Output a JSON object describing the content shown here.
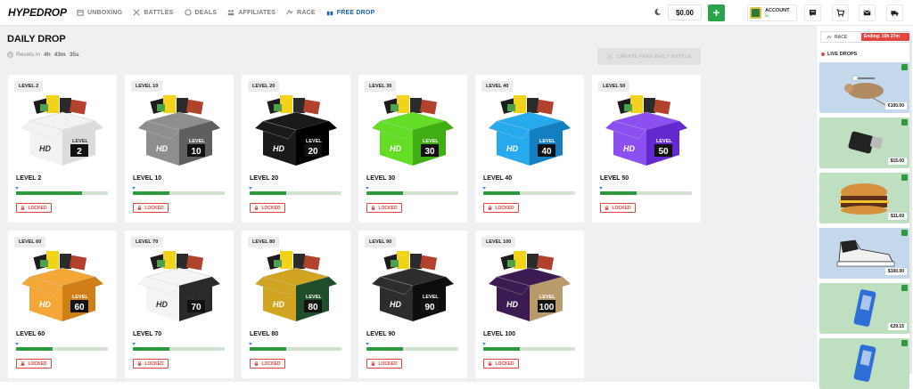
{
  "header": {
    "logo": "HYPEDROP",
    "nav": [
      {
        "label": "UNBOXING",
        "icon": "box-icon"
      },
      {
        "label": "BATTLES",
        "icon": "swords-icon"
      },
      {
        "label": "DEALS",
        "icon": "deals-icon"
      },
      {
        "label": "AFFILIATES",
        "icon": "affiliates-icon"
      },
      {
        "label": "RACE",
        "icon": "race-icon"
      },
      {
        "label": "FREE DROP",
        "icon": "gift-icon",
        "active": true
      }
    ],
    "balance": "$0.00",
    "account_label": "ACCOUNT",
    "account_sub": "$0"
  },
  "page": {
    "title": "DAILY DROP",
    "resets_label": "Resets in",
    "resets_h": "4h",
    "resets_m": "43m",
    "resets_s": "35s",
    "create_button": "CREATE FREE DAILY BATTLE"
  },
  "cards": [
    {
      "tag": "LEVEL 2",
      "name": "LEVEL 2",
      "box_label": "LEVEL",
      "box_num": "2",
      "color": "#f2f2f2",
      "dark": "#dcdcdc",
      "status": "LOCKED",
      "progress": 0.72
    },
    {
      "tag": "LEVEL 10",
      "name": "LEVEL 10",
      "box_label": "LEVEL",
      "box_num": "10",
      "color": "#8e8e8e",
      "dark": "#5f5f5f",
      "status": "LOCKED",
      "progress": 0.4
    },
    {
      "tag": "LEVEL 20",
      "name": "LEVEL 20",
      "box_label": "LEVEL",
      "box_num": "20",
      "color": "#1a1a1a",
      "dark": "#000000",
      "status": "LOCKED",
      "progress": 0.4
    },
    {
      "tag": "LEVEL 30",
      "name": "LEVEL 30",
      "box_label": "LEVEL",
      "box_num": "30",
      "color": "#63dd25",
      "dark": "#3fae12",
      "status": "LOCKED",
      "progress": 0.4
    },
    {
      "tag": "LEVEL 40",
      "name": "LEVEL 40",
      "box_label": "LEVEL",
      "box_num": "40",
      "color": "#27a9ee",
      "dark": "#137ec0",
      "status": "LOCKED",
      "progress": 0.4
    },
    {
      "tag": "LEVEL 50",
      "name": "LEVEL 50",
      "box_label": "LEVEL",
      "box_num": "50",
      "color": "#8c4ff0",
      "dark": "#6428cf",
      "status": "LOCKED",
      "progress": 0.4
    },
    {
      "tag": "LEVEL 60",
      "name": "LEVEL 60",
      "box_label": "LEVEL",
      "box_num": "60",
      "color": "#f4a637",
      "dark": "#d07e16",
      "status": "LOCKED",
      "progress": 0.4
    },
    {
      "tag": "LEVEL 70",
      "name": "LEVEL 70",
      "box_label": "LEVEL",
      "box_num": "70",
      "color": "#f4f4f4",
      "dark": "#2a2a2a",
      "status": "LOCKED",
      "progress": 0.4
    },
    {
      "tag": "LEVEL 80",
      "name": "LEVEL 80",
      "box_label": "LEVEL",
      "box_num": "80",
      "color": "#d1a521",
      "dark": "#1f4e2a",
      "status": "LOCKED",
      "progress": 0.4
    },
    {
      "tag": "LEVEL 90",
      "name": "LEVEL 90",
      "box_label": "LEVEL",
      "box_num": "90",
      "color": "#2d2d2d",
      "dark": "#0d0d0d",
      "status": "LOCKED",
      "progress": 0.4
    },
    {
      "tag": "LEVEL 100",
      "name": "LEVEL 100",
      "box_label": "LEVEL",
      "box_num": "100",
      "color": "#3c1a52",
      "dark": "#b99b6b",
      "status": "LOCKED",
      "progress": 0.4
    }
  ],
  "sidebar": {
    "race_label": "RACE",
    "race_ending": "Ending: 10h 27m 35s",
    "live_label": "LIVE DROPS",
    "drops": [
      {
        "price": "€100.00",
        "bg": "#c3d8ea",
        "item": "mouse-lamp"
      },
      {
        "price": "$15.00",
        "bg": "#bfe0c0",
        "item": "usb-stick"
      },
      {
        "price": "$11.69",
        "bg": "#bfe0c0",
        "item": "burger"
      },
      {
        "price": "$100.00",
        "bg": "#c3d8ea",
        "item": "sneaker"
      },
      {
        "price": "€29.15",
        "bg": "#bfe0c0",
        "item": "phone-case"
      },
      {
        "price": "",
        "bg": "#bfe0c0",
        "item": "phone-case"
      }
    ]
  },
  "colors": {
    "accent": "#2d9a3d",
    "danger": "#e0453e",
    "nav_active": "#1b5fa8"
  }
}
